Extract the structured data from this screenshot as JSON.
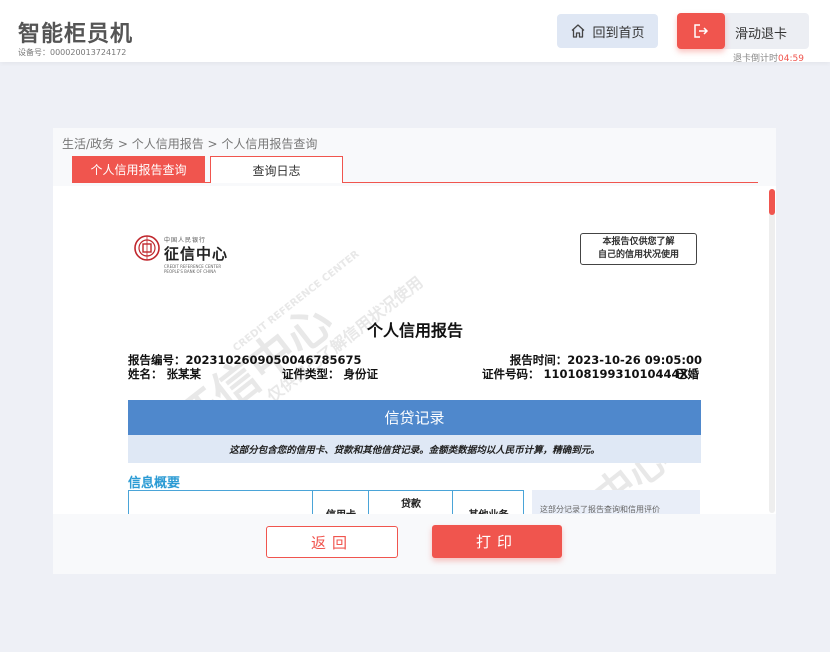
{
  "header": {
    "title": "智能柜员机",
    "device_id": "设备号：000020013724172",
    "home_label": "回到首页",
    "exit_label": "滑动退卡",
    "countdown_label": "退卡倒计时",
    "countdown_value": "04:59"
  },
  "breadcrumb": "生活/政务 > 个人信用报告 > 个人信用报告查询",
  "tabs": [
    {
      "label": "个人信用报告查询",
      "active": true
    },
    {
      "label": "查询日志",
      "active": false
    }
  ],
  "report": {
    "logo_top": "中国人民银行",
    "logo_name": "征信中心",
    "logo_sub1": "CREDIT REFERENCE CENTER",
    "logo_sub2": "PEOPLE'S BANK OF CHINA",
    "disclaimer_line1": "本报告仅供您了解",
    "disclaimer_line2": "自己的信用状况使用",
    "title": "个人信用报告",
    "report_no": "报告编号：2023102609050046785675",
    "report_time": "报告时间：2023-10-26 09:05:00",
    "name": "姓名：  张某某",
    "id_type": "证件类型：  身份证",
    "id_number": "证件号码：  11010819931010444X",
    "marital": "已婚",
    "section_title": "信贷记录",
    "section_note": "这部分包含您的信用卡、贷款和其他信贷记录。金额类数据均以人民币计算，精确到元。",
    "info_summary": "信息概要",
    "table_headers": [
      "信用卡",
      "贷款",
      "其他业务"
    ],
    "side_note": "这部分记录了报告查询和信用评价",
    "watermark_big": "征信中心",
    "watermark_sub": "CREDIT REFERENCE CENTER",
    "watermark_use": "仅供自己了解信用状况使用"
  },
  "buttons": {
    "back": "返回",
    "print": "打印"
  },
  "colors": {
    "accent": "#f0554e",
    "section_blue": "#4f88cc",
    "summary_blue": "#2b9bd4"
  }
}
